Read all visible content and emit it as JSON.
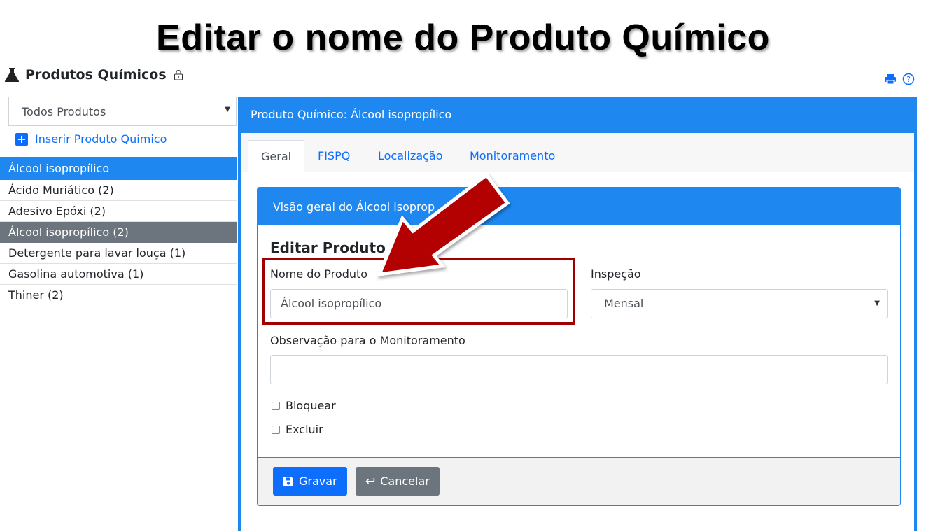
{
  "headline": "Editar o nome do Produto Químico",
  "app": {
    "title": "Produtos Químicos"
  },
  "sidebar": {
    "filter_value": "Todos Produtos",
    "insert_label": "Inserir Produto Químico",
    "selected_header": "Álcool isopropílico",
    "items": [
      {
        "label": "Ácido Muriático (2)"
      },
      {
        "label": "Adesivo Epóxi (2)"
      },
      {
        "label": "Álcool isopropílico (2)"
      },
      {
        "label": "Detergente para lavar louça (1)"
      },
      {
        "label": "Gasolina automotiva (1)"
      },
      {
        "label": "Thiner (2)"
      }
    ]
  },
  "panel": {
    "title": "Produto Químico: Álcool isopropílico",
    "tabs": [
      {
        "label": "Geral"
      },
      {
        "label": "FISPQ"
      },
      {
        "label": "Localização"
      },
      {
        "label": "Monitoramento"
      }
    ],
    "card_title": "Visão geral do Álcool isoprop",
    "form_title": "Editar Produto (",
    "fields": {
      "name_label": "Nome do Produto",
      "name_value": "Álcool isopropílico",
      "inspection_label": "Inspeção",
      "inspection_value": "Mensal",
      "note_label": "Observação para o Monitoramento",
      "note_value": ""
    },
    "checks": {
      "block": "Bloquear",
      "delete": "Excluir"
    },
    "buttons": {
      "save": "Gravar",
      "cancel": "Cancelar"
    }
  },
  "colors": {
    "primary": "#1e88f0",
    "button_primary": "#0d6efd",
    "button_secondary": "#6c757d",
    "annotation": "#a00000"
  }
}
